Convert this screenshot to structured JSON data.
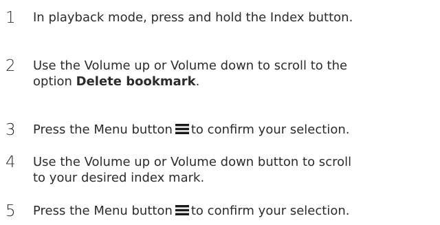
{
  "steps": [
    {
      "number": "1",
      "text": "In playback mode, press and hold the Index button."
    },
    {
      "number": "2",
      "line1": "Use the Volume up or Volume down to scroll to the",
      "line2_prefix": "option ",
      "line2_bold": "Delete bookmark",
      "line2_suffix": "."
    },
    {
      "number": "3",
      "before_icon": "Press the Menu button",
      "icon": "menu-icon",
      "after_icon": "to confirm your selection."
    },
    {
      "number": "4",
      "line1": "Use the Volume up or Volume down button to scroll",
      "line2": "to your desired index mark."
    },
    {
      "number": "5",
      "before_icon": "Press the Menu button",
      "icon": "menu-icon",
      "after_icon": "to confirm your selection."
    }
  ]
}
